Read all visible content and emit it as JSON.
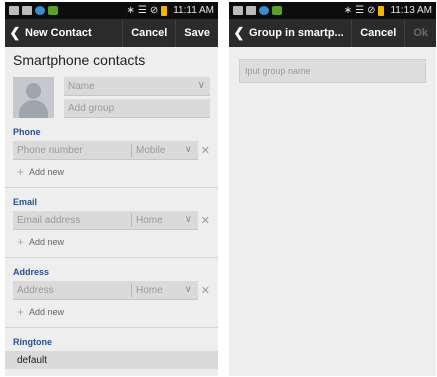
{
  "left_screen": {
    "status_time": "11:11 AM",
    "action_bar": {
      "title": "New Contact",
      "cancel": "Cancel",
      "save": "Save"
    },
    "heading": "Smartphone contacts",
    "name_placeholder": "Name",
    "group_placeholder": "Add group",
    "phone": {
      "label": "Phone",
      "placeholder": "Phone number",
      "type": "Mobile",
      "add_new": "Add new"
    },
    "email": {
      "label": "Email",
      "placeholder": "Email address",
      "type": "Home",
      "add_new": "Add new"
    },
    "address": {
      "label": "Address",
      "placeholder": "Address",
      "type": "Home",
      "add_new": "Add new"
    },
    "ringtone": {
      "label": "Ringtone",
      "value": "default"
    }
  },
  "right_screen": {
    "status_time": "11:13 AM",
    "action_bar": {
      "title": "Group in smartp...",
      "cancel": "Cancel",
      "ok": "Ok"
    },
    "group_name_placeholder": "Iput group name"
  },
  "icons": {
    "back": "chevron-left-icon",
    "dropdown": "chevron-down-icon",
    "remove": "close-icon",
    "add": "plus-icon",
    "avatar": "contact-avatar-icon"
  },
  "colors": {
    "section_label": "#2c4f91",
    "action_bar": "#2b2b2b",
    "status_bar": "#0d0d0d",
    "background": "#eeeeee"
  }
}
